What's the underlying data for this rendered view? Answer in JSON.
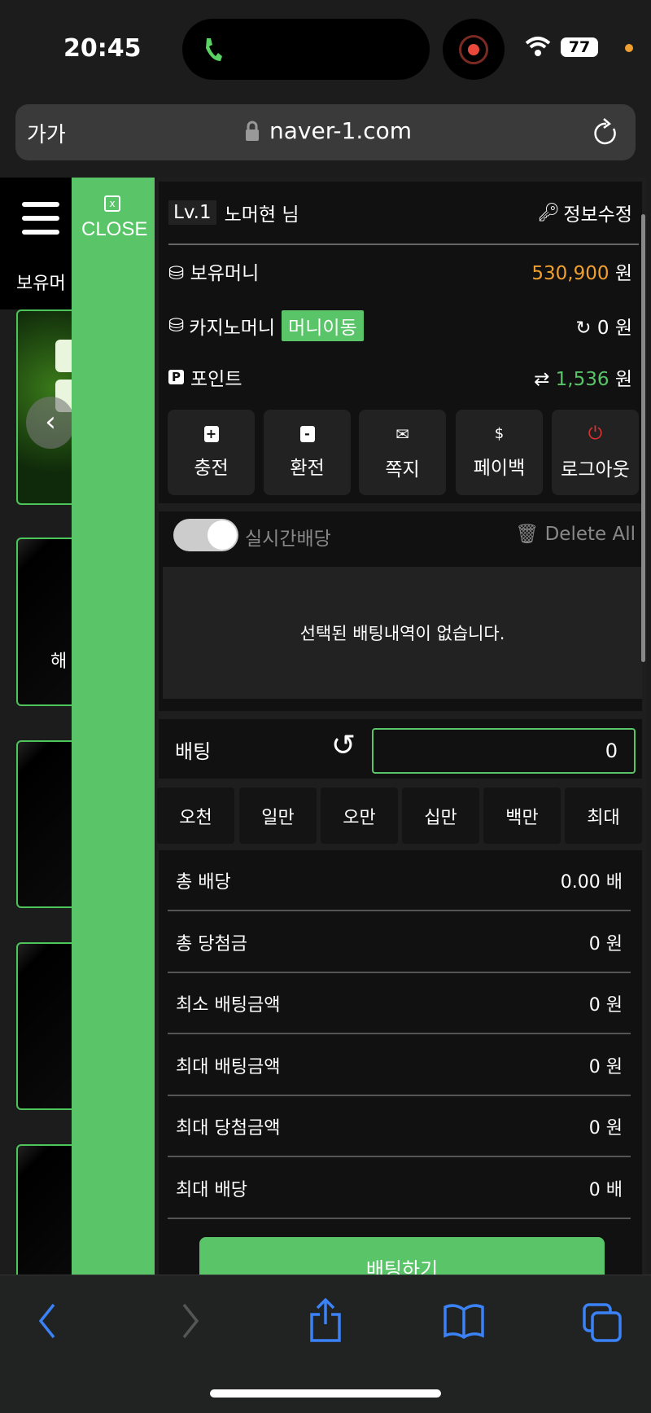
{
  "status": {
    "time": "20:45",
    "battery": "77"
  },
  "browser": {
    "text_size": "가가",
    "url": "naver-1.com"
  },
  "background": {
    "balance_label": "보유머",
    "card_text": "해"
  },
  "sidebar": {
    "close_label": "CLOSE"
  },
  "user": {
    "level": "Lv.1",
    "name": "노머현 님",
    "edit_label": "정보수정"
  },
  "wallet": {
    "money_label": "보유머니",
    "money_value": "530,900",
    "money_unit": "원",
    "casino_label": "카지노머니",
    "move_button": "머니이동",
    "casino_value": "0",
    "casino_unit": "원",
    "point_label": "포인트",
    "point_value": "1,536",
    "point_unit": "원"
  },
  "actions": [
    {
      "label": "충전",
      "icon": "plus-square"
    },
    {
      "label": "환전",
      "icon": "minus-square"
    },
    {
      "label": "쪽지",
      "icon": "envelope"
    },
    {
      "label": "페이백",
      "icon": "hand-dollar"
    },
    {
      "label": "로그아웃",
      "icon": "power"
    }
  ],
  "betslip": {
    "realtime_label": "실시간배당",
    "realtime_on": true,
    "delete_all": "Delete All",
    "empty_message": "선택된 배팅내역이 없습니다."
  },
  "betting": {
    "label": "배팅",
    "amount": "0",
    "quick_amounts": [
      "오천",
      "일만",
      "오만",
      "십만",
      "백만",
      "최대"
    ]
  },
  "summary": [
    {
      "label": "총 배당",
      "value": "0.00 배"
    },
    {
      "label": "총 당첨금",
      "value": "0 원"
    },
    {
      "label": "최소 배팅금액",
      "value": "0 원"
    },
    {
      "label": "최대 배팅금액",
      "value": "0 원"
    },
    {
      "label": "최대 당첨금액",
      "value": "0 원"
    },
    {
      "label": "최대 배당",
      "value": "0 배"
    }
  ],
  "submit_label": "배팅하기",
  "colors": {
    "accent": "#5ac469",
    "money": "#f0a030",
    "points": "#5ac469",
    "logout": "#e03030"
  }
}
